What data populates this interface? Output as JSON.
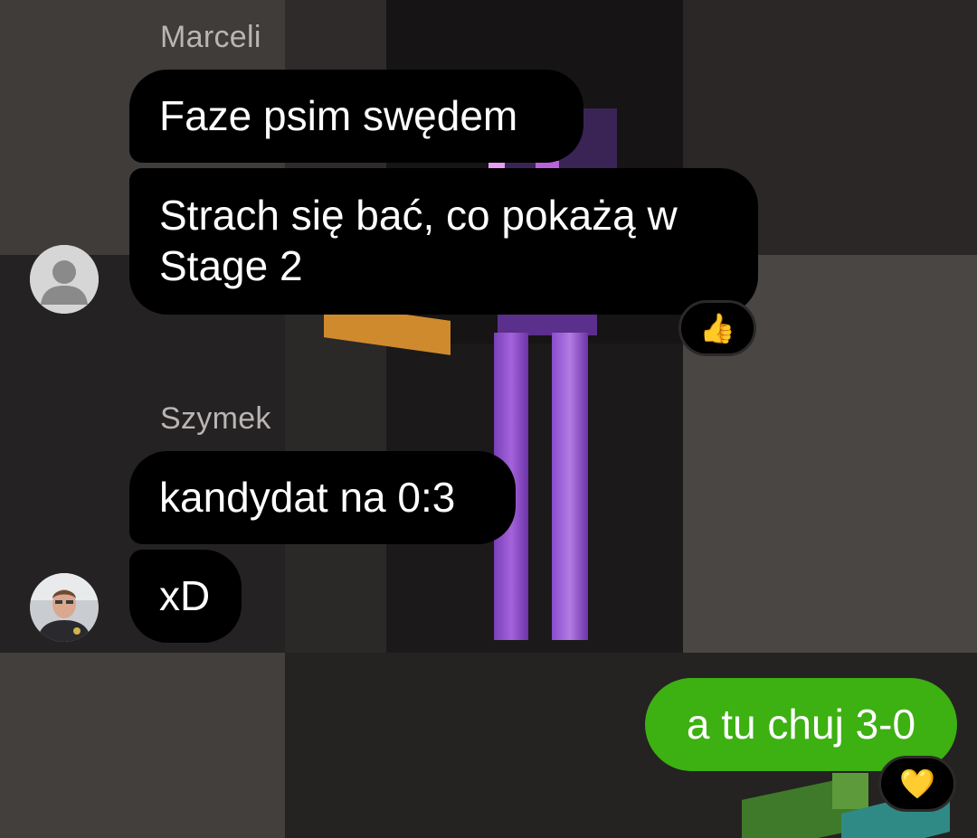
{
  "chat": {
    "groups": [
      {
        "sender": "Marceli",
        "avatar_icon": "default-user-icon",
        "messages": [
          {
            "text": "Faze psim swędem"
          },
          {
            "text": "Strach się bać, co pokażą w Stage 2",
            "reaction": "👍"
          }
        ]
      },
      {
        "sender": "Szymek",
        "avatar_icon": "user-photo",
        "messages": [
          {
            "text": "kandydat na 0:3"
          },
          {
            "text": "xD"
          }
        ]
      }
    ],
    "outgoing": [
      {
        "text": "a tu chuj 3-0",
        "reaction": "💛"
      }
    ]
  },
  "colors": {
    "incoming_bubble": "#000000",
    "outgoing_bubble": "#3db012",
    "sender_name": "#b9b5b3",
    "text": "#ffffff"
  }
}
